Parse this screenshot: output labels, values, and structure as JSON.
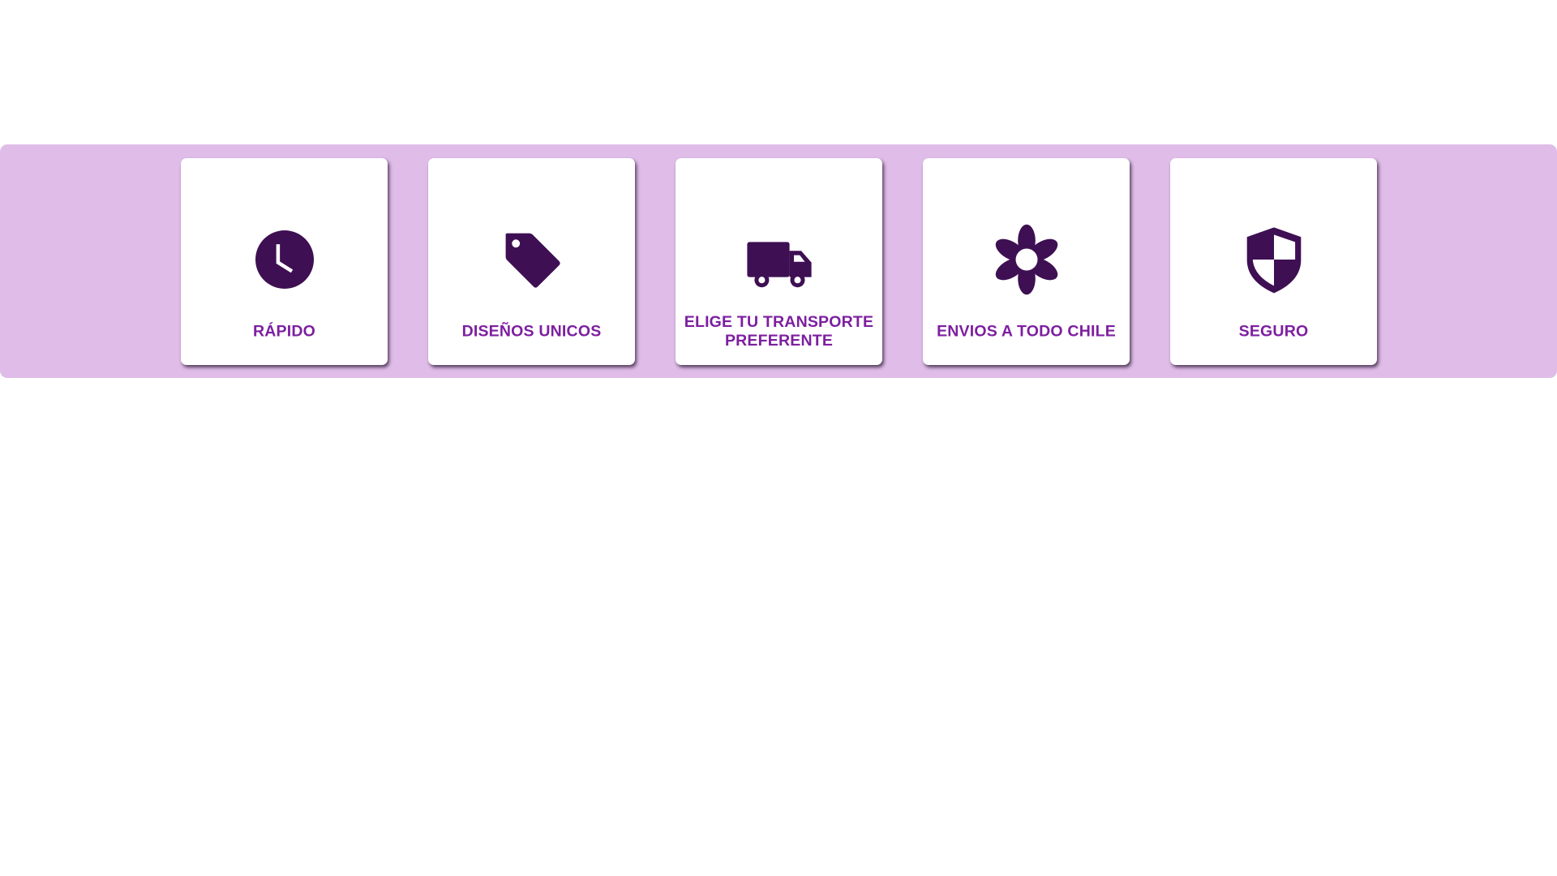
{
  "colors": {
    "band_background": "#dfbde8",
    "card_background": "#ffffff",
    "icon_color": "#3e0f52",
    "label_color": "#7d1fa0"
  },
  "features": [
    {
      "label": "RÁPIDO",
      "icon": "clock-icon"
    },
    {
      "label": "DISEÑOS UNICOS",
      "icon": "tag-icon"
    },
    {
      "label": "ELIGE TU TRANSPORTE PREFERENTE",
      "icon": "truck-icon"
    },
    {
      "label": "ENVIOS A TODO CHILE",
      "icon": "flower-icon"
    },
    {
      "label": "SEGURO",
      "icon": "shield-icon"
    }
  ]
}
